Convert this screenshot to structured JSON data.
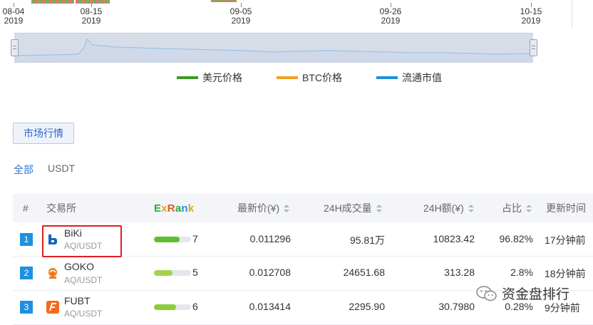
{
  "timeline": {
    "dates": [
      {
        "label": "08-04",
        "year": "2019"
      },
      {
        "label": "08-15",
        "year": "2019"
      },
      {
        "label": "09-05",
        "year": "2019"
      },
      {
        "label": "09-26",
        "year": "2019"
      },
      {
        "label": "10-15",
        "year": "2019"
      }
    ]
  },
  "legend": {
    "usd_price": "美元价格",
    "btc_price": "BTC价格",
    "market_cap": "流通市值",
    "colors": {
      "usd": "#3c9a1f",
      "btc": "#f0a020",
      "cap": "#1e90e0"
    }
  },
  "market_button": "市场行情",
  "filters": {
    "all": "全部",
    "usdt": "USDT"
  },
  "table": {
    "headers": {
      "rank": "#",
      "exchange": "交易所",
      "exrank": "ExRank",
      "price": "最新价(¥)",
      "volume": "24H成交量",
      "amount": "24H额(¥)",
      "share": "占比",
      "updated": "更新时间"
    },
    "rows": [
      {
        "rank": "1",
        "name": "BiKi",
        "pair": "AQ/USDT",
        "score": "7",
        "score_fraction": 0.7,
        "price": "0.011296",
        "volume": "95.81万",
        "amount": "10823.42",
        "share": "96.82%",
        "updated": "17分钟前"
      },
      {
        "rank": "2",
        "name": "GOKO",
        "pair": "AQ/USDT",
        "score": "5",
        "score_fraction": 0.5,
        "price": "0.012708",
        "volume": "24651.68",
        "amount": "313.28",
        "share": "2.8%",
        "updated": "18分钟前"
      },
      {
        "rank": "3",
        "name": "FUBT",
        "pair": "AQ/USDT",
        "score": "6",
        "score_fraction": 0.6,
        "price": "0.013414",
        "volume": "2295.90",
        "amount": "30.7980",
        "share": "0.28%",
        "updated": "9分钟前"
      }
    ]
  },
  "watermark": "资金盘排行"
}
